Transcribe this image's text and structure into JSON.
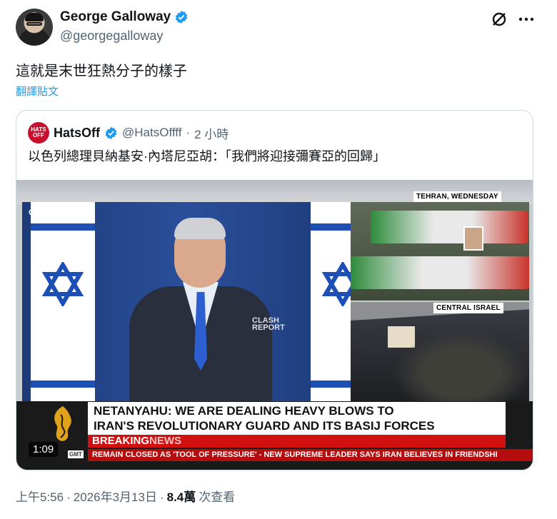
{
  "author": {
    "name": "George Galloway",
    "handle": "@georgegalloway"
  },
  "tweet": {
    "text": "這就是末世狂熱分子的樣子",
    "translate_label": "翻譯貼文"
  },
  "quoted": {
    "avatar_text": "HATS OFF",
    "name": "HatsOff",
    "handle": "@HatsOffff",
    "separator": "·",
    "time_ago": "2 小時",
    "text": "以色列總理貝納基安·內塔尼亞胡：「我們將迎接彌賽亞的回歸」"
  },
  "video": {
    "gpo_label": "GPO",
    "watermark_line1": "CLASH",
    "watermark_line2": "REPORT",
    "caption_top": "TEHRAN, WEDNESDAY",
    "caption_bottom": "CENTRAL ISRAEL",
    "headline_line1": "NETANYAHU: WE ARE DEALING HEAVY BLOWS TO",
    "headline_line2": "IRAN'S REVOLUTIONARY GUARD AND ITS BASIJ FORCES",
    "breaking_word": "BREAKING",
    "news_word": "NEWS",
    "crawl_text": "REMAIN CLOSED AS 'TOOL OF PRESSURE'  -  NEW SUPREME LEADER SAYS IRAN BELIEVES IN FRIENDSHI",
    "gmt_label": "GMT",
    "duration": "1:09"
  },
  "meta": {
    "time": "上午5:56",
    "date": "2026年3月13日",
    "separator1": "·",
    "separator2": "·",
    "views_count": "8.4萬",
    "views_label": "次查看"
  },
  "colors": {
    "accent": "#1d9bf0",
    "secondary_text": "#536471",
    "breaking_red": "#d11010"
  },
  "icons": [
    "verified-badge-icon",
    "grok-icon",
    "more-options-icon",
    "al-jazeera-logo-icon"
  ]
}
